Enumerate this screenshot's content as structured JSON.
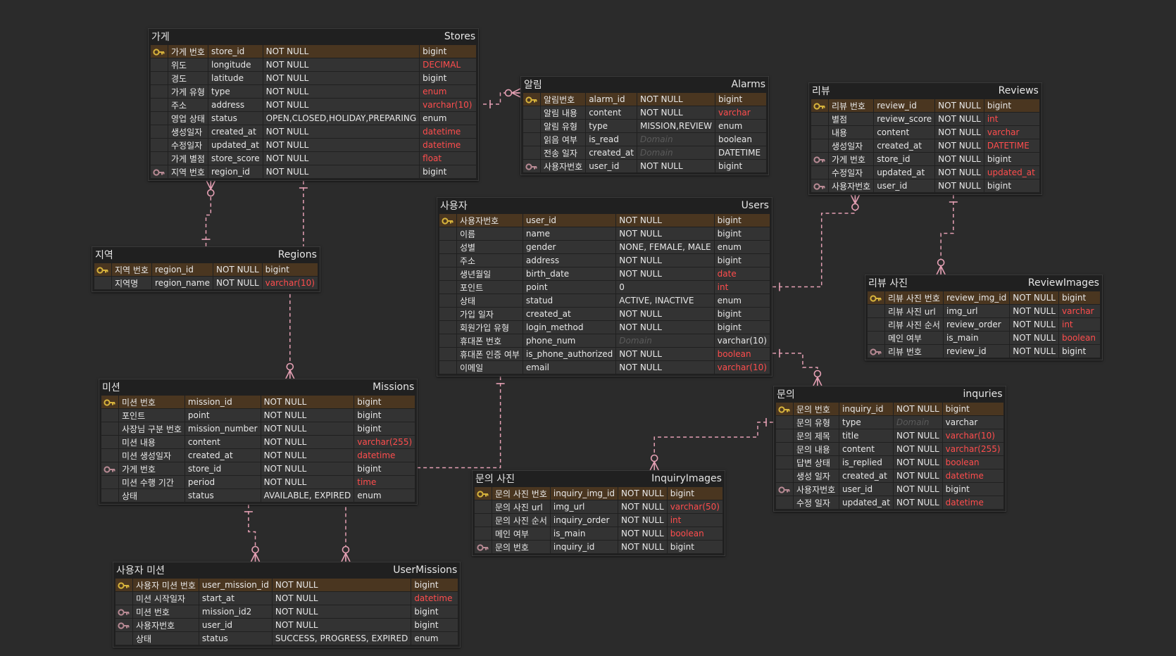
{
  "colors": {
    "background": "#2b2b2b",
    "table_bg": "#202020",
    "row_bg": "#333333",
    "pk_row_bg": "#4a3620",
    "text": "#e8e8e8",
    "highlight_type": "#ff4d4d",
    "connector": "#e5a0b4",
    "pk_key": "#d8b43c",
    "fk_key": "#b88a94"
  },
  "entities": {
    "stores": {
      "logical": "가게",
      "physical": "Stores",
      "columns": [
        {
          "key": "pk",
          "logical": "가게 번호",
          "physical": "store_id",
          "domain": "NOT NULL",
          "type": "bigint",
          "type_highlight": false
        },
        {
          "key": "",
          "logical": "위도",
          "physical": "longitude",
          "domain": "NOT NULL",
          "type": "DECIMAL",
          "type_highlight": true
        },
        {
          "key": "",
          "logical": "경도",
          "physical": "latitude",
          "domain": "NOT NULL",
          "type": "bigint",
          "type_highlight": false
        },
        {
          "key": "",
          "logical": "가게 유형",
          "physical": "type",
          "domain": "NOT NULL",
          "type": "enum",
          "type_highlight": true
        },
        {
          "key": "",
          "logical": "주소",
          "physical": "address",
          "domain": "NOT NULL",
          "type": "varchar(10)",
          "type_highlight": true
        },
        {
          "key": "",
          "logical": "영업 상태",
          "physical": "status",
          "domain": "OPEN,CLOSED,HOLIDAY,PREPARING",
          "type": "enum",
          "type_highlight": false
        },
        {
          "key": "",
          "logical": "생성일자",
          "physical": "created_at",
          "domain": "NOT NULL",
          "type": "datetime",
          "type_highlight": true
        },
        {
          "key": "",
          "logical": "수정일자",
          "physical": "updated_at",
          "domain": "NOT NULL",
          "type": "datetime",
          "type_highlight": true
        },
        {
          "key": "",
          "logical": "가게 별점",
          "physical": "store_score",
          "domain": "NOT NULL",
          "type": "float",
          "type_highlight": true
        },
        {
          "key": "fk",
          "logical": "지역 번호",
          "physical": "region_id",
          "domain": "NOT NULL",
          "type": "bigint",
          "type_highlight": false
        }
      ]
    },
    "alarms": {
      "logical": "알림",
      "physical": "Alarms",
      "columns": [
        {
          "key": "pk",
          "logical": "알림번호",
          "physical": "alarm_id",
          "domain": "NOT NULL",
          "type": "bigint",
          "type_highlight": false
        },
        {
          "key": "",
          "logical": "알림 내용",
          "physical": "content",
          "domain": "NOT NULL",
          "type": "varchar",
          "type_highlight": true
        },
        {
          "key": "",
          "logical": "알림 유형",
          "physical": "type",
          "domain": "MISSION,REVIEW",
          "type": "enum",
          "type_highlight": false
        },
        {
          "key": "",
          "logical": "읽음 여부",
          "physical": "is_read",
          "domain": "Domain",
          "domain_placeholder": true,
          "type": "boolean",
          "type_highlight": false
        },
        {
          "key": "",
          "logical": "전송 일자",
          "physical": "created_at",
          "domain": "Domain",
          "domain_placeholder": true,
          "type": "DATETIME",
          "type_highlight": false
        },
        {
          "key": "fk",
          "logical": "사용자번호",
          "physical": "user_id",
          "domain": "NOT NULL",
          "type": "bigint",
          "type_highlight": false
        }
      ]
    },
    "reviews": {
      "logical": "리뷰",
      "physical": "Reviews",
      "columns": [
        {
          "key": "pk",
          "logical": "리뷰 번호",
          "physical": "review_id",
          "domain": "NOT NULL",
          "type": "bigint",
          "type_highlight": false
        },
        {
          "key": "",
          "logical": "별점",
          "physical": "review_score",
          "domain": "NOT NULL",
          "type": "int",
          "type_highlight": true
        },
        {
          "key": "",
          "logical": "내용",
          "physical": "content",
          "domain": "NOT NULL",
          "type": "varchar",
          "type_highlight": true
        },
        {
          "key": "",
          "logical": "생성일자",
          "physical": "created_at",
          "domain": "NOT NULL",
          "type": "DATETIME",
          "type_highlight": true
        },
        {
          "key": "fk",
          "logical": "가게 번호",
          "physical": "store_id",
          "domain": "NOT NULL",
          "type": "bigint",
          "type_highlight": false
        },
        {
          "key": "",
          "logical": "수정일자",
          "physical": "updated_at",
          "domain": "NOT NULL",
          "type": "updated_at",
          "type_highlight": true
        },
        {
          "key": "fk",
          "logical": "사용자번호",
          "physical": "user_id",
          "domain": "NOT NULL",
          "type": "bigint",
          "type_highlight": false
        }
      ]
    },
    "regions": {
      "logical": "지역",
      "physical": "Regions",
      "columns": [
        {
          "key": "pk",
          "logical": "지역 번호",
          "physical": "region_id",
          "domain": "NOT NULL",
          "type": "bigint",
          "type_highlight": false
        },
        {
          "key": "",
          "logical": "지역명",
          "physical": "region_name",
          "domain": "NOT NULL",
          "type": "varchar(10)",
          "type_highlight": true
        }
      ]
    },
    "users": {
      "logical": "사용자",
      "physical": "Users",
      "columns": [
        {
          "key": "pk",
          "logical": "사용자번호",
          "physical": "user_id",
          "domain": "NOT NULL",
          "type": "bigint",
          "type_highlight": false
        },
        {
          "key": "",
          "logical": "이름",
          "physical": "name",
          "domain": "NOT NULL",
          "type": "bigint",
          "type_highlight": false
        },
        {
          "key": "",
          "logical": "성별",
          "physical": "gender",
          "domain": "NONE, FEMALE, MALE",
          "type": "enum",
          "type_highlight": false
        },
        {
          "key": "",
          "logical": "주소",
          "physical": "address",
          "domain": "NOT NULL",
          "type": "bigint",
          "type_highlight": false
        },
        {
          "key": "",
          "logical": "생년월일",
          "physical": "birth_date",
          "domain": "NOT NULL",
          "type": "date",
          "type_highlight": true
        },
        {
          "key": "",
          "logical": "포인트",
          "physical": "point",
          "domain": "0",
          "type": "int",
          "type_highlight": true
        },
        {
          "key": "",
          "logical": "상태",
          "physical": "statud",
          "domain": "ACTIVE, INACTIVE",
          "type": "enum",
          "type_highlight": false
        },
        {
          "key": "",
          "logical": "가입 일자",
          "physical": "created_at",
          "domain": "NOT NULL",
          "type": "bigint",
          "type_highlight": false
        },
        {
          "key": "",
          "logical": "회원가입 유형",
          "physical": "login_method",
          "domain": "NOT NULL",
          "type": "bigint",
          "type_highlight": false
        },
        {
          "key": "",
          "logical": "휴대폰 번호",
          "physical": "phone_num",
          "domain": "Domain",
          "domain_placeholder": true,
          "type": "varchar(10)",
          "type_highlight": false
        },
        {
          "key": "",
          "logical": "휴대폰 인증 여부",
          "physical": "is_phone_authorized",
          "domain": "NOT NULL",
          "type": "boolean",
          "type_highlight": true
        },
        {
          "key": "",
          "logical": "이메일",
          "physical": "email",
          "domain": "NOT NULL",
          "type": "varchar(10)",
          "type_highlight": true
        }
      ]
    },
    "review_images": {
      "logical": "리뷰 사진",
      "physical": "ReviewImages",
      "columns": [
        {
          "key": "pk",
          "logical": "리뷰 사진 번호",
          "physical": "review_img_id",
          "domain": "NOT NULL",
          "type": "bigint",
          "type_highlight": false
        },
        {
          "key": "",
          "logical": "리뷰 사진 url",
          "physical": "img_url",
          "domain": "NOT NULL",
          "type": "varchar",
          "type_highlight": true
        },
        {
          "key": "",
          "logical": "리뷰 사진 순서",
          "physical": "review_order",
          "domain": "NOT NULL",
          "type": "int",
          "type_highlight": true
        },
        {
          "key": "",
          "logical": "메인 여부",
          "physical": "is_main",
          "domain": "NOT NULL",
          "type": "boolean",
          "type_highlight": true
        },
        {
          "key": "fk",
          "logical": "리뷰 번호",
          "physical": "review_id",
          "domain": "NOT NULL",
          "type": "bigint",
          "type_highlight": false
        }
      ]
    },
    "missions": {
      "logical": "미션",
      "physical": "Missions",
      "columns": [
        {
          "key": "pk",
          "logical": "미션 번호",
          "physical": "mission_id",
          "domain": "NOT NULL",
          "type": "bigint",
          "type_highlight": false
        },
        {
          "key": "",
          "logical": "포인트",
          "physical": "point",
          "domain": "NOT NULL",
          "type": "bigint",
          "type_highlight": false
        },
        {
          "key": "",
          "logical": "사장님 구분 번호",
          "physical": "mission_number",
          "domain": "NOT NULL",
          "type": "bigint",
          "type_highlight": false
        },
        {
          "key": "",
          "logical": "미션 내용",
          "physical": "content",
          "domain": "NOT NULL",
          "type": "varchar(255)",
          "type_highlight": true
        },
        {
          "key": "",
          "logical": "미션 생성일자",
          "physical": "created_at",
          "domain": "NOT NULL",
          "type": "datetime",
          "type_highlight": true
        },
        {
          "key": "fk",
          "logical": "가게 번호",
          "physical": "store_id",
          "domain": "NOT NULL",
          "type": "bigint",
          "type_highlight": false
        },
        {
          "key": "",
          "logical": "미션 수행 기간",
          "physical": "period",
          "domain": "NOT NULL",
          "type": "time",
          "type_highlight": true
        },
        {
          "key": "",
          "logical": "상태",
          "physical": "status",
          "domain": "AVAILABLE, EXPIRED",
          "type": "enum",
          "type_highlight": false
        }
      ]
    },
    "inquiries": {
      "logical": "문의",
      "physical": "inquries",
      "columns": [
        {
          "key": "pk",
          "logical": "문의 번호",
          "physical": "inquiry_id",
          "domain": "NOT NULL",
          "type": "bigint",
          "type_highlight": false
        },
        {
          "key": "",
          "logical": "문의 유형",
          "physical": "type",
          "domain": "Domain",
          "domain_placeholder": true,
          "type": "varchar",
          "type_highlight": false
        },
        {
          "key": "",
          "logical": "문의 제목",
          "physical": "title",
          "domain": "NOT NULL",
          "type": "varchar(10)",
          "type_highlight": true
        },
        {
          "key": "",
          "logical": "문의 내용",
          "physical": "content",
          "domain": "NOT NULL",
          "type": "varchar(255)",
          "type_highlight": true
        },
        {
          "key": "",
          "logical": "답변 상태",
          "physical": "is_replied",
          "domain": "NOT NULL",
          "type": "boolean",
          "type_highlight": true
        },
        {
          "key": "",
          "logical": "생성 일자",
          "physical": "created_at",
          "domain": "NOT NULL",
          "type": "datetime",
          "type_highlight": true
        },
        {
          "key": "fk",
          "logical": "사용자번호",
          "physical": "user_id",
          "domain": "NOT NULL",
          "type": "bigint",
          "type_highlight": false
        },
        {
          "key": "",
          "logical": "수정 일자",
          "physical": "updated_at",
          "domain": "NOT NULL",
          "type": "datetime",
          "type_highlight": true
        }
      ]
    },
    "inquiry_images": {
      "logical": "문의 사진",
      "physical": "InquiryImages",
      "columns": [
        {
          "key": "pk",
          "logical": "문의 사진 번호",
          "physical": "inquiry_img_id",
          "domain": "NOT NULL",
          "type": "bigint",
          "type_highlight": false
        },
        {
          "key": "",
          "logical": "문의 사진 url",
          "physical": "img_url",
          "domain": "NOT NULL",
          "type": "varchar(50)",
          "type_highlight": true
        },
        {
          "key": "",
          "logical": "문의 사진 순서",
          "physical": "inquiry_order",
          "domain": "NOT NULL",
          "type": "int",
          "type_highlight": true
        },
        {
          "key": "",
          "logical": "메인 여부",
          "physical": "is_main",
          "domain": "NOT NULL",
          "type": "boolean",
          "type_highlight": true
        },
        {
          "key": "fk",
          "logical": "문의 번호",
          "physical": "inquiry_id",
          "domain": "NOT NULL",
          "type": "bigint",
          "type_highlight": false
        }
      ]
    },
    "user_missions": {
      "logical": "사용자 미션",
      "physical": "UserMissions",
      "columns": [
        {
          "key": "pk",
          "logical": "사용자 미션 번호",
          "physical": "user_mission_id",
          "domain": "NOT NULL",
          "type": "bigint",
          "type_highlight": false
        },
        {
          "key": "",
          "logical": "미션 시작일자",
          "physical": "start_at",
          "domain": "NOT NULL",
          "type": "datetime",
          "type_highlight": true
        },
        {
          "key": "fk",
          "logical": "미션 번호",
          "physical": "mission_id2",
          "domain": "NOT NULL",
          "type": "bigint",
          "type_highlight": false
        },
        {
          "key": "fk",
          "logical": "사용자번호",
          "physical": "user_id",
          "domain": "NOT NULL",
          "type": "bigint",
          "type_highlight": false
        },
        {
          "key": "",
          "logical": "상태",
          "physical": "status",
          "domain": "SUCCESS, PROGRESS, EXPIRED",
          "type": "enum",
          "type_highlight": false
        }
      ]
    }
  },
  "relationships": [
    {
      "from": "regions",
      "to": "stores"
    },
    {
      "from": "stores",
      "to": "missions"
    },
    {
      "from": "users",
      "to": "alarms"
    },
    {
      "from": "users",
      "to": "reviews"
    },
    {
      "from": "reviews",
      "to": "review_images"
    },
    {
      "from": "users",
      "to": "inquiries"
    },
    {
      "from": "inquiries",
      "to": "inquiry_images"
    },
    {
      "from": "missions",
      "to": "user_missions"
    },
    {
      "from": "users",
      "to": "user_missions"
    }
  ]
}
